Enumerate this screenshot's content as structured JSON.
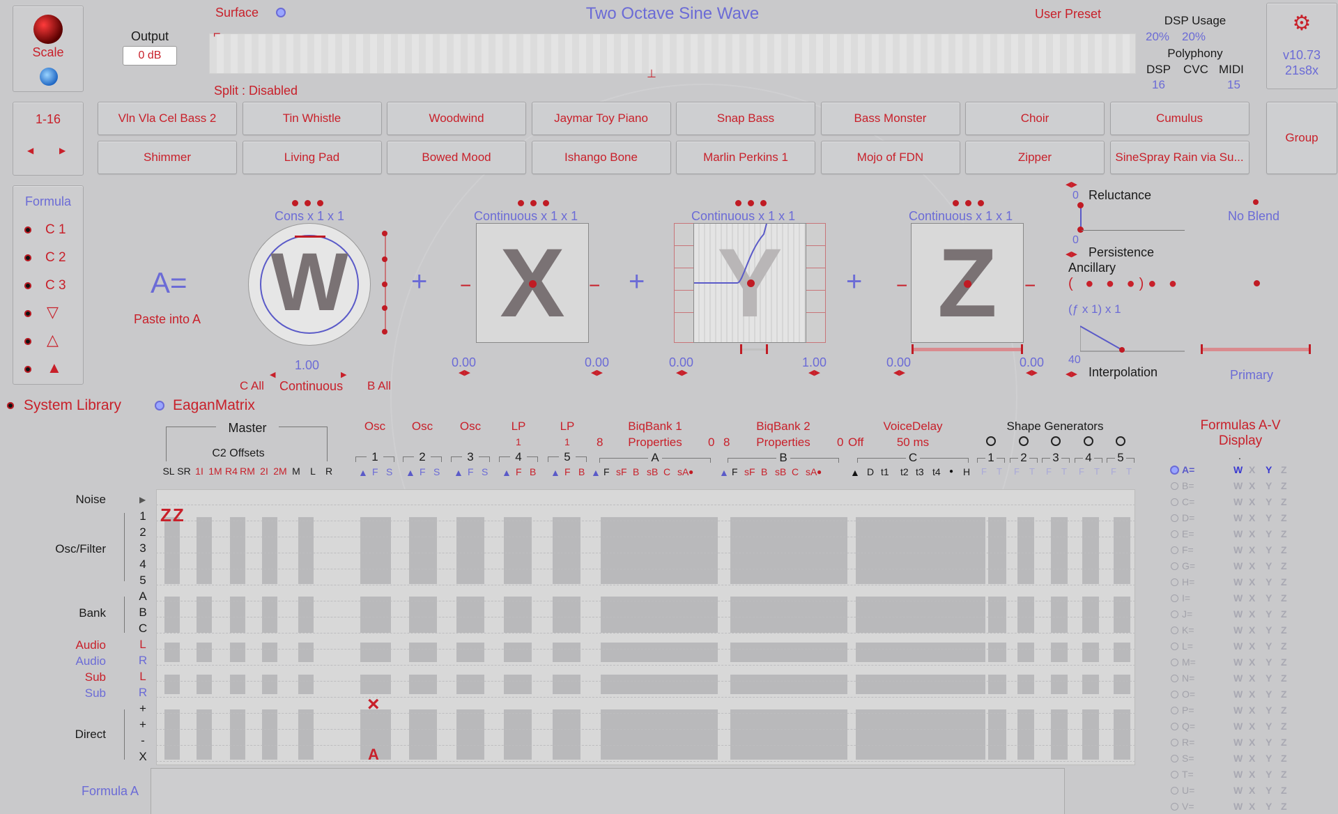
{
  "top": {
    "scale_label": "Scale",
    "output_label": "Output",
    "output_value": "0 dB",
    "surface_label": "Surface",
    "preset_title": "Two Octave Sine Wave",
    "user_preset_label": "User Preset",
    "split_label": "Split : Disabled",
    "dsp_usage_label": "DSP Usage",
    "dsp_usage_1": "20%",
    "dsp_usage_2": "20%",
    "polyphony_label": "Polyphony",
    "poly_headers": [
      "DSP",
      "CVC",
      "MIDI"
    ],
    "poly_values": [
      "16",
      "",
      "15"
    ],
    "version": "v10.73",
    "build": "21s8x",
    "gear_icon": "gear-icon"
  },
  "presets": {
    "bank_label": "1-16",
    "group_label": "Group",
    "row1": [
      "Vln Vla Cel Bass 2",
      "Tin Whistle",
      "Woodwind",
      "Jaymar Toy Piano",
      "Snap Bass",
      "Bass Monster",
      "Choir",
      "Cumulus"
    ],
    "row2": [
      "Shimmer",
      "Living Pad",
      "Bowed Mood",
      "Ishango Bone",
      "Marlin Perkins 1",
      "Mojo of FDN",
      "Zipper",
      "SineSpray Rain via Su..."
    ]
  },
  "formula": {
    "title": "Formula",
    "items": [
      "C 1",
      "C 2",
      "C 3"
    ],
    "a_label": "A=",
    "paste_label": "Paste into A",
    "w_title": "Cons x 1 x 1",
    "x_title": "Continuous x 1 x 1",
    "y_title": "Continuous x 1 x 1",
    "z_title": "Continuous x 1 x 1",
    "w_value": "1.00",
    "x_left": "0.00",
    "x_right": "0.00",
    "y_left": "0.00",
    "y_right": "1.00",
    "z_left": "0.00",
    "z_right": "0.00",
    "c_all": "C All",
    "continuous": "Continuous",
    "b_all": "B All",
    "reluctance": "Reluctance",
    "rel_top": "0",
    "rel_bottom": "0",
    "persistence": "Persistence",
    "ancillary": "Ancillary",
    "ancillary_dots": "( ● ● ●)● ●",
    "fx": "(ƒ x 1) x 1",
    "interp_value": "40",
    "interpolation": "Interpolation",
    "no_blend": "No Blend",
    "primary": "Primary"
  },
  "library": {
    "system_library": "System Library",
    "eagan_matrix": "EaganMatrix"
  },
  "matrix": {
    "master_label": "Master",
    "c2_offsets": "C2 Offsets",
    "master_cols": [
      "SL",
      "SR",
      "1I",
      "1M",
      "R4",
      "RM",
      "2I",
      "2M",
      "M",
      "L",
      "R"
    ],
    "osc_headers": [
      "Osc",
      "Osc",
      "Osc",
      "LP",
      "LP"
    ],
    "osc_nums": [
      "1",
      "2",
      "3",
      "4",
      "5"
    ],
    "lp_sub": [
      "1",
      "1"
    ],
    "bank_headers": [
      "BiqBank 1",
      "BiqBank 2"
    ],
    "bank_sub": [
      "Properties",
      "Properties"
    ],
    "bank_nums": [
      "8",
      "0",
      "8",
      "0",
      "Off"
    ],
    "bank_letters": [
      "A",
      "B"
    ],
    "voice_delay": "VoiceDelay",
    "voice_delay_value": "50 ms",
    "voice_letter": "C",
    "shape_generators": "Shape Generators",
    "shape_nums": [
      "1",
      "2",
      "3",
      "4",
      "5"
    ],
    "fs": [
      "F",
      "S"
    ],
    "fb": [
      "F",
      "B"
    ],
    "bank_cols": [
      "F",
      "sF",
      "B",
      "sB",
      "C",
      "sA"
    ],
    "voice_cols": [
      "D",
      "t1",
      "t2",
      "t3",
      "t4",
      "H"
    ],
    "ft": [
      "F",
      "T"
    ],
    "rows_left": {
      "noise": "Noise",
      "osc_filter": "Osc/Filter",
      "bank": "Bank",
      "audio_l": "Audio",
      "audio_r": "Audio",
      "sub_l": "Sub",
      "sub_r": "Sub",
      "direct": "Direct"
    },
    "row_keys": [
      "1",
      "2",
      "3",
      "4",
      "5",
      "A",
      "B",
      "C",
      "L",
      "R",
      "L",
      "R",
      "+",
      "+",
      "-",
      "X"
    ],
    "zz": "ZZ",
    "x_mark": "×",
    "a_mark": "A"
  },
  "formulas_av": {
    "title": "Formulas A-V",
    "subtitle": "Display",
    "letters": [
      "A=",
      "B=",
      "C=",
      "D=",
      "E=",
      "F=",
      "G=",
      "H=",
      "I=",
      "J=",
      "K=",
      "L=",
      "M=",
      "N=",
      "O=",
      "P=",
      "Q=",
      "R=",
      "S=",
      "T=",
      "U=",
      "V="
    ],
    "cols": [
      "W",
      "X",
      "Y",
      "Z"
    ],
    "dot": "."
  },
  "bottom": {
    "formula_a": "Formula A"
  }
}
